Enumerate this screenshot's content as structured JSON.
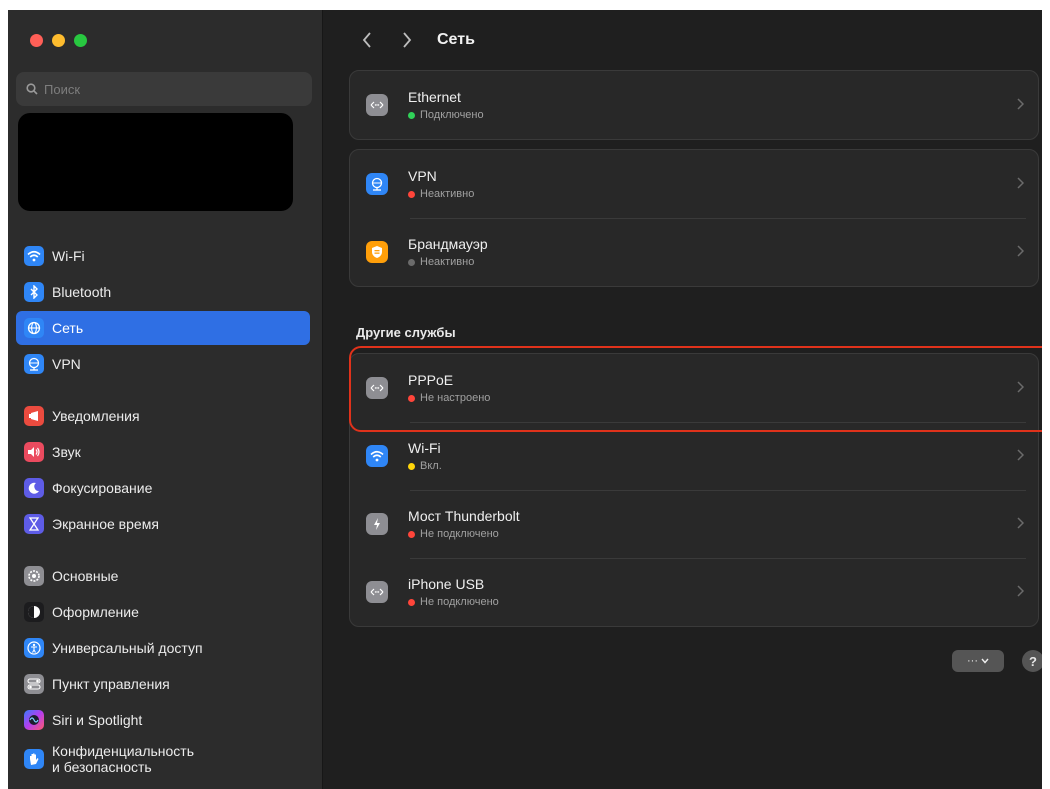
{
  "window": {
    "title": "Сеть"
  },
  "search": {
    "placeholder": "Поиск"
  },
  "sidebar": {
    "items": [
      {
        "label": "Wi-Fi",
        "icon": "wifi-icon",
        "color": "#2f86f6"
      },
      {
        "label": "Bluetooth",
        "icon": "bluetooth-icon",
        "color": "#2f86f6"
      },
      {
        "label": "Сеть",
        "icon": "globe-icon",
        "color": "#2f86f6",
        "active": true
      },
      {
        "label": "VPN",
        "icon": "vpn-globe-icon",
        "color": "#2f86f6"
      },
      {
        "label": "Уведомления",
        "icon": "notifications-icon",
        "color": "#eb4b3f"
      },
      {
        "label": "Звук",
        "icon": "sound-icon",
        "color": "#eb4b5f"
      },
      {
        "label": "Фокусирование",
        "icon": "moon-icon",
        "color": "#5e5ce6"
      },
      {
        "label": "Экранное время",
        "icon": "hourglass-icon",
        "color": "#5e5ce6"
      },
      {
        "label": "Основные",
        "icon": "gear-icon",
        "color": "#8e8e93"
      },
      {
        "label": "Оформление",
        "icon": "appearance-icon",
        "color": "#1c1c1e"
      },
      {
        "label": "Универсальный доступ",
        "icon": "accessibility-icon",
        "color": "#2f86f6"
      },
      {
        "label": "Пункт управления",
        "icon": "control-center-icon",
        "color": "#8e8e93"
      },
      {
        "label": "Siri и Spotlight",
        "icon": "siri-icon",
        "color": "#a03df0"
      },
      {
        "label": "Конфиденциальность",
        "label2": "и безопасность",
        "icon": "privacy-hand-icon",
        "color": "#2f86f6"
      }
    ]
  },
  "main": {
    "services": [
      {
        "name": "Ethernet",
        "status": "Подключено",
        "status_color": "#30d158",
        "icon": "ethernet-icon"
      }
    ],
    "vpn_group": [
      {
        "name": "VPN",
        "status": "Неактивно",
        "status_color": "#ff453a",
        "icon": "vpn-globe-icon"
      },
      {
        "name": "Брандмауэр",
        "status": "Неактивно",
        "status_color": "#6b6b6b",
        "icon": "firewall-icon"
      }
    ],
    "other_title": "Другие службы",
    "other_services": [
      {
        "name": "PPPoE",
        "status": "Не настроено",
        "status_color": "#ff453a",
        "icon": "ethernet-icon"
      },
      {
        "name": "Wi-Fi",
        "status": "Вкл.",
        "status_color": "#ffd60a",
        "icon": "wifi-icon"
      },
      {
        "name": "Мост Thunderbolt",
        "status": "Не подключено",
        "status_color": "#ff453a",
        "icon": "thunderbolt-icon"
      },
      {
        "name": "iPhone USB",
        "status": "Не подключено",
        "status_color": "#ff453a",
        "icon": "ethernet-icon"
      }
    ],
    "more_label": "···",
    "help_label": "?"
  }
}
